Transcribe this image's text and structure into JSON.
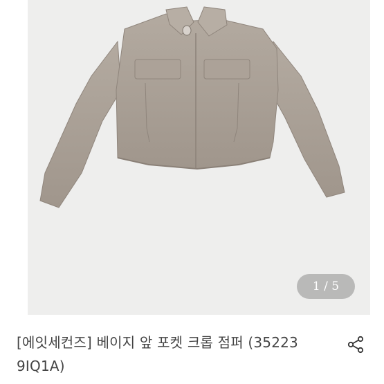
{
  "product": {
    "title": "[에잇세컨즈] 베이지 앞 포켓 크롭 점퍼 (35223 9IQ1A)",
    "image_counter": "1 / 5",
    "image_alt": "beige cropped jacket with front pockets"
  },
  "colors": {
    "jacket": "#a89e94",
    "background": "#eeeeed",
    "counter_bg": "#8c8c8c",
    "text": "#444444"
  },
  "icons": {
    "share": "share-icon"
  }
}
